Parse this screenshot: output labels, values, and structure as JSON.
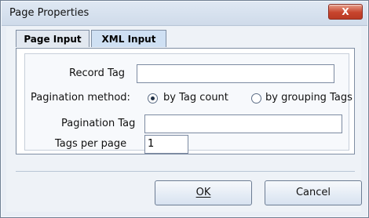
{
  "window": {
    "title": "Page Properties",
    "close_label": "X"
  },
  "tabs": [
    {
      "label": "Page Input",
      "active": false
    },
    {
      "label": "XML Input",
      "active": true
    }
  ],
  "fields": {
    "record_tag": {
      "label": "Record Tag",
      "value": ""
    },
    "pagination_method": {
      "label": "Pagination method:",
      "options": [
        {
          "label": "by Tag count",
          "selected": true
        },
        {
          "label": "by grouping Tags",
          "selected": false
        }
      ]
    },
    "pagination_tag": {
      "label": "Pagination Tag",
      "value": ""
    },
    "tags_per_page": {
      "label": "Tags per page",
      "value": "1"
    }
  },
  "buttons": {
    "ok": {
      "label": "OK",
      "mnemonic": "O"
    },
    "cancel": {
      "label": "Cancel",
      "mnemonic": "C"
    }
  },
  "icons": {
    "close": "close-icon"
  },
  "colors": {
    "accent": "#c7442d",
    "panel_bg": "#f7f9fc",
    "window_bg": "#e9eef5"
  }
}
